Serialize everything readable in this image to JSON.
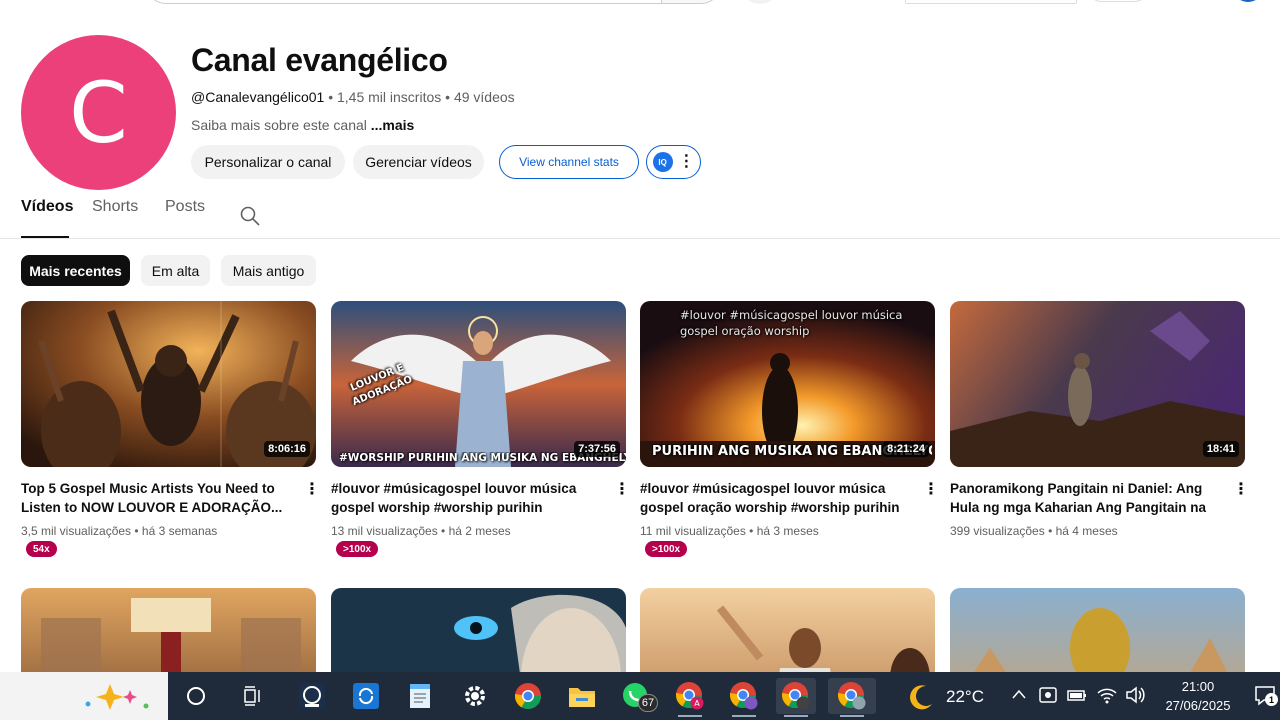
{
  "channel": {
    "avatar_letter": "C",
    "avatar_color": "#ec407a",
    "name": "Canal evangélico",
    "handle": "@Canalevangélico01",
    "separator": " • ",
    "subscribers": "1,45 mil inscritos",
    "video_count": "49 vídeos",
    "about": "Saiba mais sobre este canal",
    "about_more": "...mais"
  },
  "actions": {
    "customize": "Personalizar o canal",
    "manage": "Gerenciar vídeos",
    "stats": "View channel stats",
    "ext_badge": "IQ"
  },
  "tabs": [
    {
      "label": "Vídeos",
      "active": true
    },
    {
      "label": "Shorts",
      "active": false
    },
    {
      "label": "Posts",
      "active": false
    }
  ],
  "chips": [
    {
      "label": "Mais recentes",
      "active": true
    },
    {
      "label": "Em alta",
      "active": false
    },
    {
      "label": "Mais antigo",
      "active": false
    }
  ],
  "videos": [
    {
      "title": "Top 5 Gospel Music Artists You Need to Listen to NOW LOUVOR E ADORAÇÃO...",
      "views": "3,5 mil visualizações",
      "age": "há 3 semanas",
      "duration": "8:06:16",
      "badge": "54x"
    },
    {
      "title": "#louvor #músicagospel louvor música gospel worship #worship purihin musika...",
      "views": "13 mil visualizações",
      "age": "há 2 meses",
      "duration": "7:37:56",
      "badge": ">100x",
      "overlay_left": "LOUVOR E ADORAÇÃO",
      "overlay_bottom": "#WORSHIP PURIHIN ANG MUSIKA NG EBANGHELYO"
    },
    {
      "title": "#louvor #músicagospel louvor música gospel oração worship #worship purihin an...",
      "views": "11 mil visualizações",
      "age": "há 3 meses",
      "duration": "8:21:24",
      "badge": ">100x",
      "overlay_top": "#louvor #músicagospel louvor música gospel oração worship",
      "overlay_bottom": "PURIHIN ANG MUSIKA NG EBANGHELYO"
    },
    {
      "title": "Panoramikong Pangitain ni Daniel: Ang Hula ng mga Kaharian Ang Pangitain na Humuo...",
      "views": "399 visualizações",
      "age": "há 4 meses",
      "duration": "18:41",
      "badge": ""
    }
  ],
  "taskbar": {
    "whatsapp_count": "67",
    "temperature": "22°C",
    "time": "21:00",
    "date": "27/06/2025",
    "notification_count": "1"
  }
}
